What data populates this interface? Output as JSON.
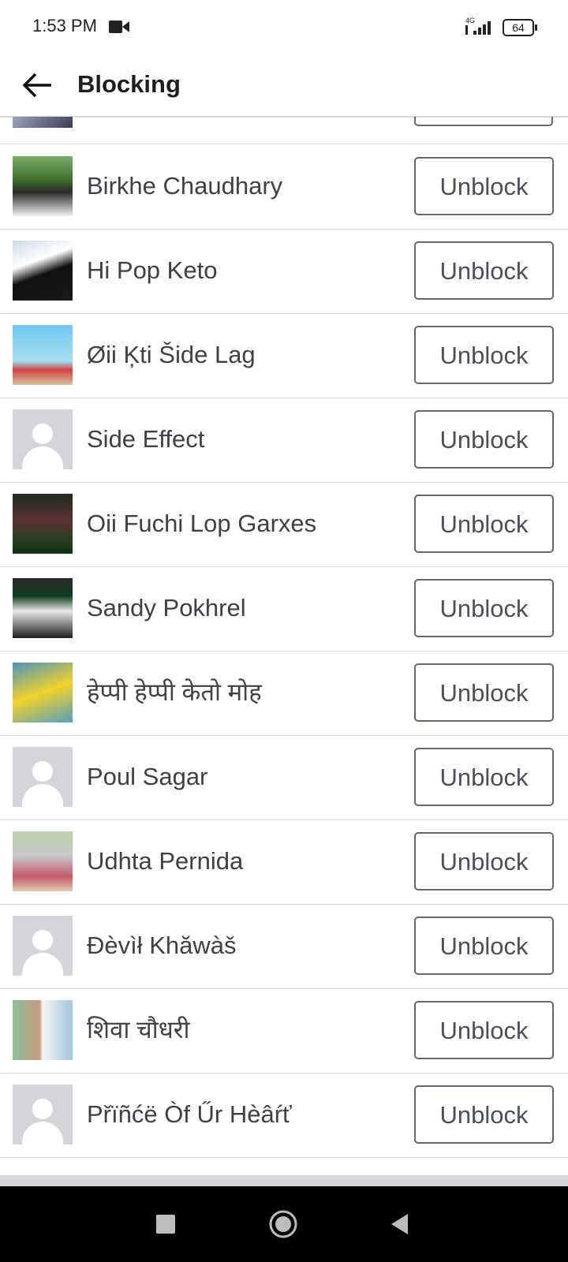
{
  "status": {
    "time": "1:53 PM",
    "network": "4G",
    "battery": "64"
  },
  "header": {
    "title": "Blocking"
  },
  "list": {
    "button_label": "Unblock",
    "items": [
      {
        "name": "Birkhe Chaudhary",
        "avatar": "photo"
      },
      {
        "name": "Hi Pop Keto",
        "avatar": "photo"
      },
      {
        "name": "Øii Ķti Šide Lag",
        "avatar": "photo"
      },
      {
        "name": "Side Effect",
        "avatar": "default"
      },
      {
        "name": "Oii Fuchi Lop Garxes",
        "avatar": "photo"
      },
      {
        "name": "Sandy Pokhrel",
        "avatar": "photo"
      },
      {
        "name": "हेप्पी हेप्पी केतो मोह",
        "avatar": "photo"
      },
      {
        "name": "Poul Sagar",
        "avatar": "default"
      },
      {
        "name": "Udhta Pernida",
        "avatar": "photo"
      },
      {
        "name": "Đèvìł Khăwàš",
        "avatar": "default"
      },
      {
        "name": "शिवा चौधरी",
        "avatar": "photo"
      },
      {
        "name": "Přïñćë Òf Űr Hèâŕť",
        "avatar": "default"
      }
    ]
  },
  "colors": {
    "divider": "#d8d9db",
    "button_border": "#606770",
    "text": "#3d4045",
    "default_avatar": "#d3d5db"
  }
}
